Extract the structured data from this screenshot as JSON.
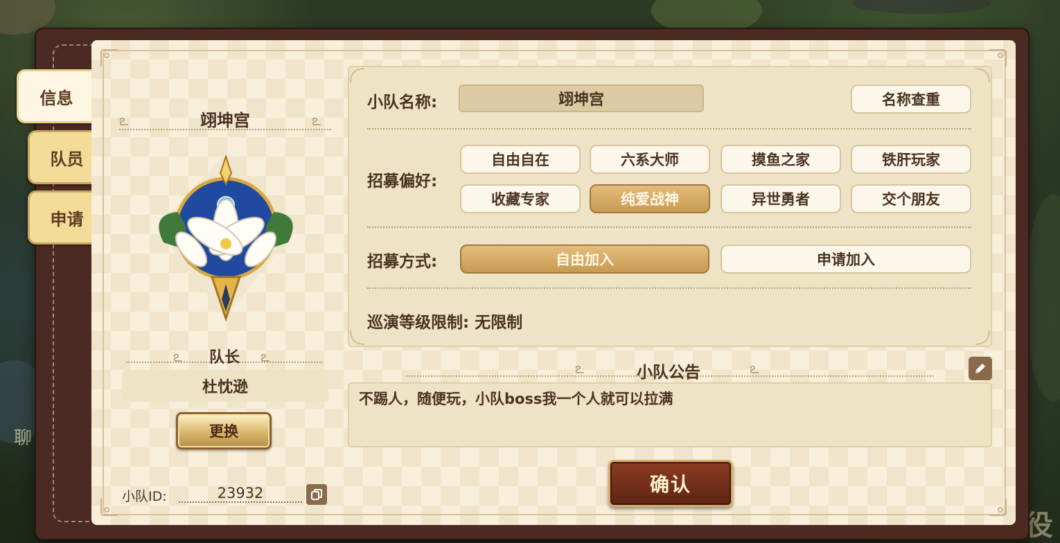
{
  "tabs": [
    {
      "label": "信息",
      "active": true
    },
    {
      "label": "队员",
      "active": false
    },
    {
      "label": "申请",
      "active": false
    }
  ],
  "team": {
    "name": "翊坤宫",
    "leader_label": "队长",
    "leader_name": "杜忱逊",
    "change_label": "更换",
    "id_label": "小队ID:",
    "id_value": "23932"
  },
  "settings": {
    "name_label": "小队名称:",
    "name_value": "翊坤宫",
    "check_name_label": "名称查重",
    "preference_label": "招募偏好:",
    "preferences": [
      {
        "label": "自由自在",
        "selected": false
      },
      {
        "label": "六系大师",
        "selected": false
      },
      {
        "label": "摸鱼之家",
        "selected": false
      },
      {
        "label": "铁肝玩家",
        "selected": false
      },
      {
        "label": "收藏专家",
        "selected": false
      },
      {
        "label": "纯爱战神",
        "selected": true
      },
      {
        "label": "异世勇者",
        "selected": false
      },
      {
        "label": "交个朋友",
        "selected": false
      }
    ],
    "method_label": "招募方式:",
    "methods": [
      {
        "label": "自由加入",
        "selected": true
      },
      {
        "label": "申请加入",
        "selected": false
      }
    ],
    "level_limit": "巡演等级限制: 无限制"
  },
  "notice": {
    "title": "小队公告",
    "text": "不踢人，随便玩，小队boss我一个人就可以拉满"
  },
  "confirm_label": "确认",
  "background_hints": {
    "chat": "聊",
    "corner": "战役"
  },
  "colors": {
    "panel_bg": "#f8efda",
    "selected_pill": "#c99a52",
    "confirm_bg": "#6e2c18",
    "text_brown": "#4a3222"
  }
}
